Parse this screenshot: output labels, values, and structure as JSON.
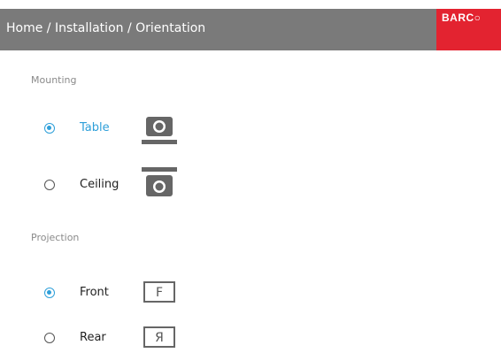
{
  "header": {
    "breadcrumb": "Home / Installation / Orientation",
    "logo_text": "BARC○",
    "bg_color": "#7a7a7a",
    "logo_color": "#e32330"
  },
  "mounting": {
    "label": "Mounting",
    "options": [
      {
        "label": "Table",
        "selected": true,
        "icon": "table-mount-icon"
      },
      {
        "label": "Ceiling",
        "selected": false,
        "icon": "ceiling-mount-icon"
      }
    ]
  },
  "projection": {
    "label": "Projection",
    "options": [
      {
        "label": "Front",
        "selected": true,
        "icon": "front-projection-icon",
        "glyph": "F"
      },
      {
        "label": "Rear",
        "selected": false,
        "icon": "rear-projection-icon",
        "glyph": "Я"
      }
    ]
  },
  "colors": {
    "accent": "#2e9fd9",
    "icon_gray": "#666666"
  }
}
